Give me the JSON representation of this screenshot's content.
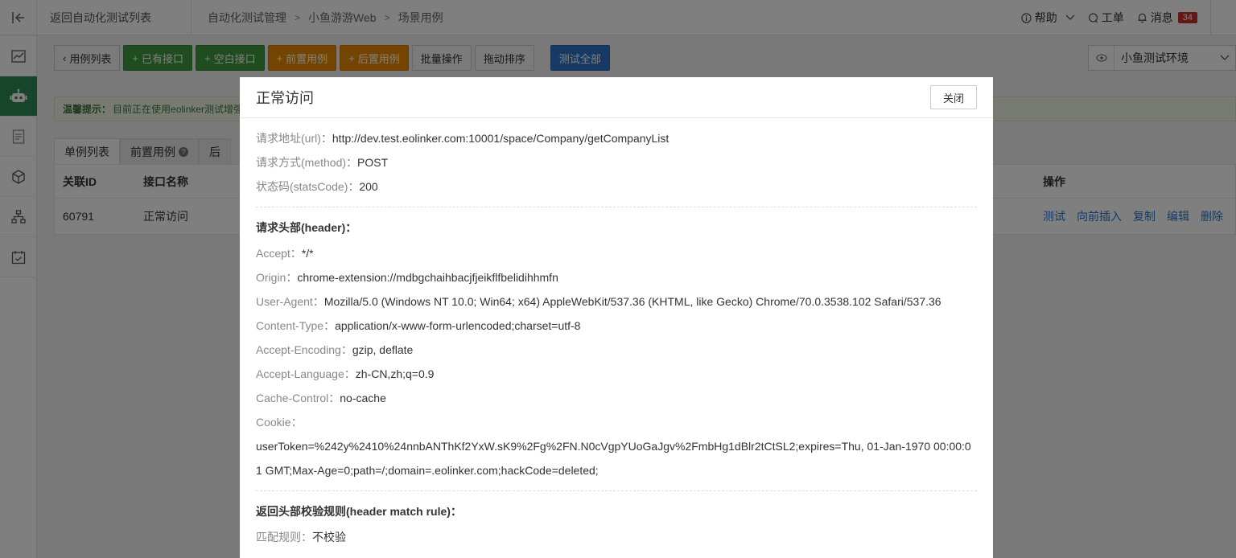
{
  "topbar": {
    "back_label": "返回自动化测试列表",
    "breadcrumb": [
      "自动化测试管理",
      "小鱼游游Web",
      "场景用例"
    ],
    "help": "帮助",
    "ticket": "工单",
    "messages": "消息",
    "message_count": "34"
  },
  "toolbar": {
    "case_list": "用例列表",
    "existing_api": "已有接口",
    "blank_api": "空白接口",
    "pre_case": "前置用例",
    "post_case": "后置用例",
    "batch": "批量操作",
    "drag_sort": "拖动排序",
    "test_all": "测试全部",
    "env": "小鱼测试环境"
  },
  "hint": {
    "label": "温馨提示：",
    "text": "目前正在使用eolinker测试增强"
  },
  "tabs": [
    "单例列表",
    "前置用例",
    "后"
  ],
  "table": {
    "headers": [
      "关联ID",
      "接口名称",
      "操作"
    ],
    "rows": [
      {
        "id": "60791",
        "name": "正常访问"
      }
    ],
    "actions": [
      "测试",
      "向前插入",
      "复制",
      "编辑",
      "删除"
    ]
  },
  "modal": {
    "title": "正常访问",
    "close": "关闭",
    "url_k": "请求地址(url)：",
    "url_v": "http://dev.test.eolinker.com:10001/space/Company/getCompanyList",
    "method_k": "请求方式(method)：",
    "method_v": "POST",
    "status_k": "状态码(statsCode)：",
    "status_v": "200",
    "header_title": "请求头部(header)：",
    "headers": [
      {
        "k": "Accept：",
        "v": "*/*"
      },
      {
        "k": "Origin：",
        "v": "chrome-extension://mdbgchaihbacjfjeikflfbelidihhmfn"
      },
      {
        "k": "User-Agent：",
        "v": "Mozilla/5.0 (Windows NT 10.0; Win64; x64) AppleWebKit/537.36 (KHTML, like Gecko) Chrome/70.0.3538.102 Safari/537.36"
      },
      {
        "k": "Content-Type：",
        "v": "application/x-www-form-urlencoded;charset=utf-8"
      },
      {
        "k": "Accept-Encoding：",
        "v": "gzip, deflate"
      },
      {
        "k": "Accept-Language：",
        "v": "zh-CN,zh;q=0.9"
      },
      {
        "k": "Cache-Control：",
        "v": "no-cache"
      },
      {
        "k": "Cookie：",
        "v": ""
      }
    ],
    "cookie_value": "userToken=%242y%2410%24nnbANThKf2YxW.sK9%2Fg%2FN.N0cVgpYUoGaJgv%2FmbHg1dBlr2tCtSL2;expires=Thu, 01-Jan-1970 00:00:01 GMT;Max-Age=0;path=/;domain=.eolinker.com;hackCode=deleted;",
    "match_title": "返回头部校验规则(header match rule)：",
    "match_k": "匹配规则：",
    "match_v": "不校验"
  }
}
